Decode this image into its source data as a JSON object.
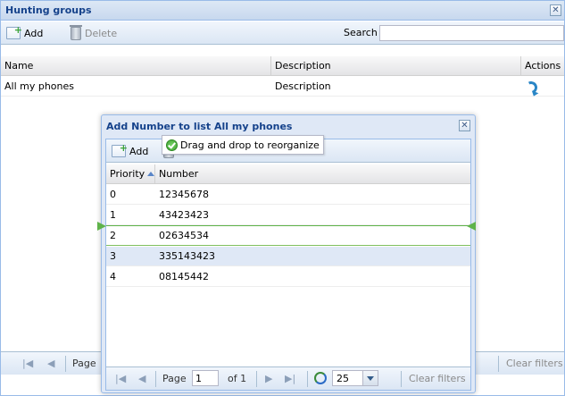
{
  "window": {
    "title": "Hunting groups",
    "close_glyph": "✕",
    "toolbar": {
      "add_label": "Add",
      "delete_label": "Delete",
      "search_label": "Search",
      "search_value": ""
    },
    "grid": {
      "columns": [
        "Name",
        "Description",
        "Actions"
      ],
      "rows": [
        {
          "name": "All my phones",
          "description": "Description",
          "action_icon": "phone-forward-icon"
        }
      ]
    },
    "paging": {
      "page_label": "Page",
      "clear_filters_label": "Clear filters"
    }
  },
  "dialog": {
    "title": "Add Number to list All my phones",
    "close_glyph": "✕",
    "toolbar": {
      "add_label": "Add",
      "delete_label": "Delete"
    },
    "grid": {
      "columns": [
        "Priority",
        "Number"
      ],
      "sort": {
        "column": "Priority",
        "direction": "asc"
      },
      "rows": [
        {
          "priority": "0",
          "number": "12345678"
        },
        {
          "priority": "1",
          "number": "43423423"
        },
        {
          "priority": "2",
          "number": "02634534"
        },
        {
          "priority": "3",
          "number": "335143423"
        },
        {
          "priority": "4",
          "number": "08145442"
        }
      ],
      "selected_row": 3,
      "drop_target_row": 2
    },
    "drag_tooltip": "Drag and drop to reorganize",
    "paging": {
      "page_label": "Page",
      "page_value": "1",
      "of_label": "of 1",
      "page_size": "25",
      "clear_filters_label": "Clear filters",
      "first_glyph": "|◀",
      "prev_glyph": "◀",
      "next_glyph": "▶",
      "last_glyph": "▶|"
    }
  },
  "colors": {
    "title_text": "#15428b",
    "header_border": "#99bbe8",
    "selected_row": "#dfe8f6",
    "drop_indicator": "#5fb34a"
  }
}
